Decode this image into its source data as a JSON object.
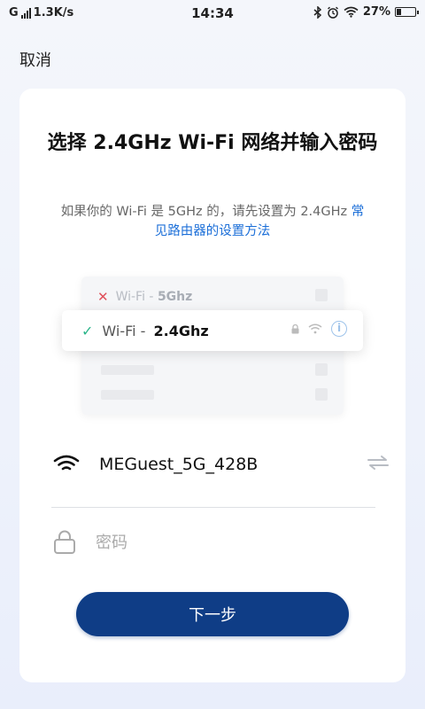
{
  "status_bar": {
    "carrier": "G",
    "speed": "1.3K/s",
    "time": "14:34",
    "battery": "27%",
    "battery_level": 0.27
  },
  "header": {
    "cancel_label": "取消"
  },
  "card": {
    "title": "选择 2.4GHz Wi-Fi 网络并输入密码",
    "subtitle_text": "如果你的 Wi-Fi 是 5GHz 的，请先设置为 2.4GHz",
    "subtitle_link": "常见路由器的设置方法",
    "illustration": {
      "row_5g_prefix": "Wi-Fi - ",
      "row_5g_band": "5Ghz",
      "row_24g_prefix": "Wi-Fi - ",
      "row_24g_band": "2.4Ghz"
    },
    "network_name": "MEGuest_5G_428B",
    "password_placeholder": "密码",
    "password_value": "",
    "next_label": "下一步"
  },
  "colors": {
    "primary_button": "#0f3d86",
    "link": "#1c6fd8",
    "check": "#2bb58a",
    "cross": "#e0505a"
  }
}
